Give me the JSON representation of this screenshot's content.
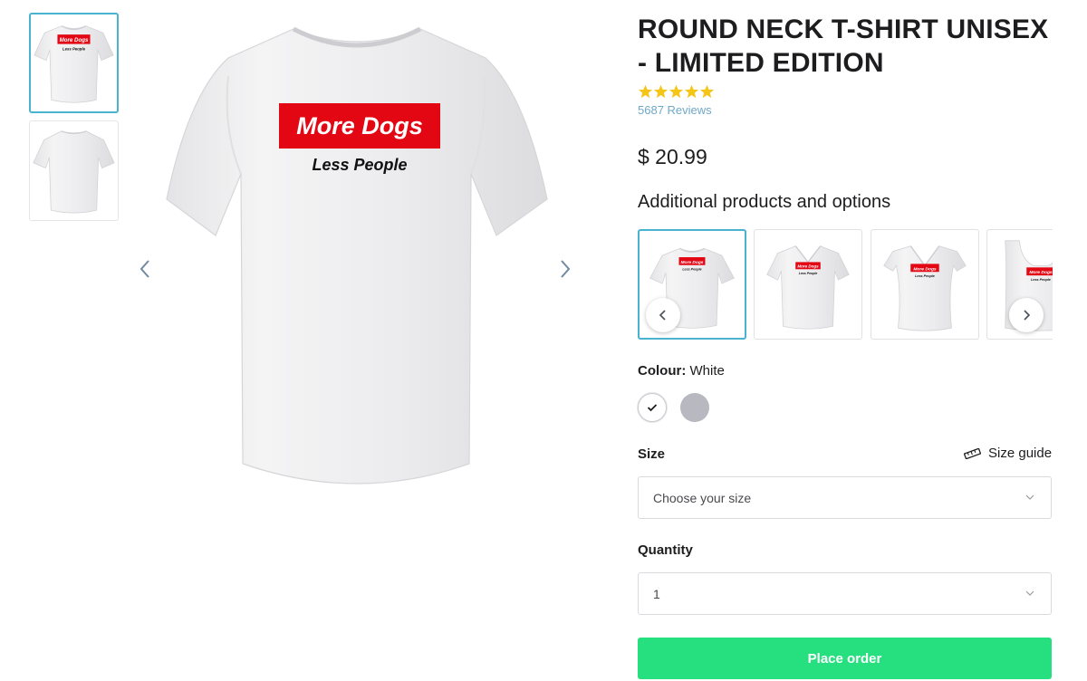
{
  "product": {
    "title": "ROUND NECK T-SHIRT UNISEX - LIMITED EDITION",
    "rating": 5,
    "reviews_label": "5687 Reviews",
    "price": "$ 20.99",
    "print_headline": "More Dogs",
    "print_subline": "Less People"
  },
  "gallery": {
    "thumbnails": [
      {
        "view": "front",
        "selected": true
      },
      {
        "view": "back",
        "selected": false
      }
    ],
    "prev_icon": "chevron-left-icon",
    "next_icon": "chevron-right-icon"
  },
  "options": {
    "heading": "Additional products and options",
    "styles": [
      {
        "style": "round-neck",
        "selected": true
      },
      {
        "style": "v-neck",
        "selected": false
      },
      {
        "style": "ladies-v-neck",
        "selected": false
      },
      {
        "style": "tank-top",
        "selected": false
      }
    ]
  },
  "colour": {
    "label": "Colour:",
    "value": "White",
    "swatches": [
      {
        "name": "White",
        "hex": "#ffffff",
        "selected": true
      },
      {
        "name": "Grey",
        "hex": "#b7b8c0",
        "selected": false
      }
    ]
  },
  "size": {
    "label": "Size",
    "guide_label": "Size guide",
    "placeholder": "Choose your size"
  },
  "quantity": {
    "label": "Quantity",
    "value": "1"
  },
  "cta": {
    "label": "Place order"
  },
  "colors": {
    "accent": "#4ab3cf",
    "cta": "#26e07f",
    "star": "#f5c518",
    "link": "#6fa8c8",
    "print_red": "#e30613"
  }
}
